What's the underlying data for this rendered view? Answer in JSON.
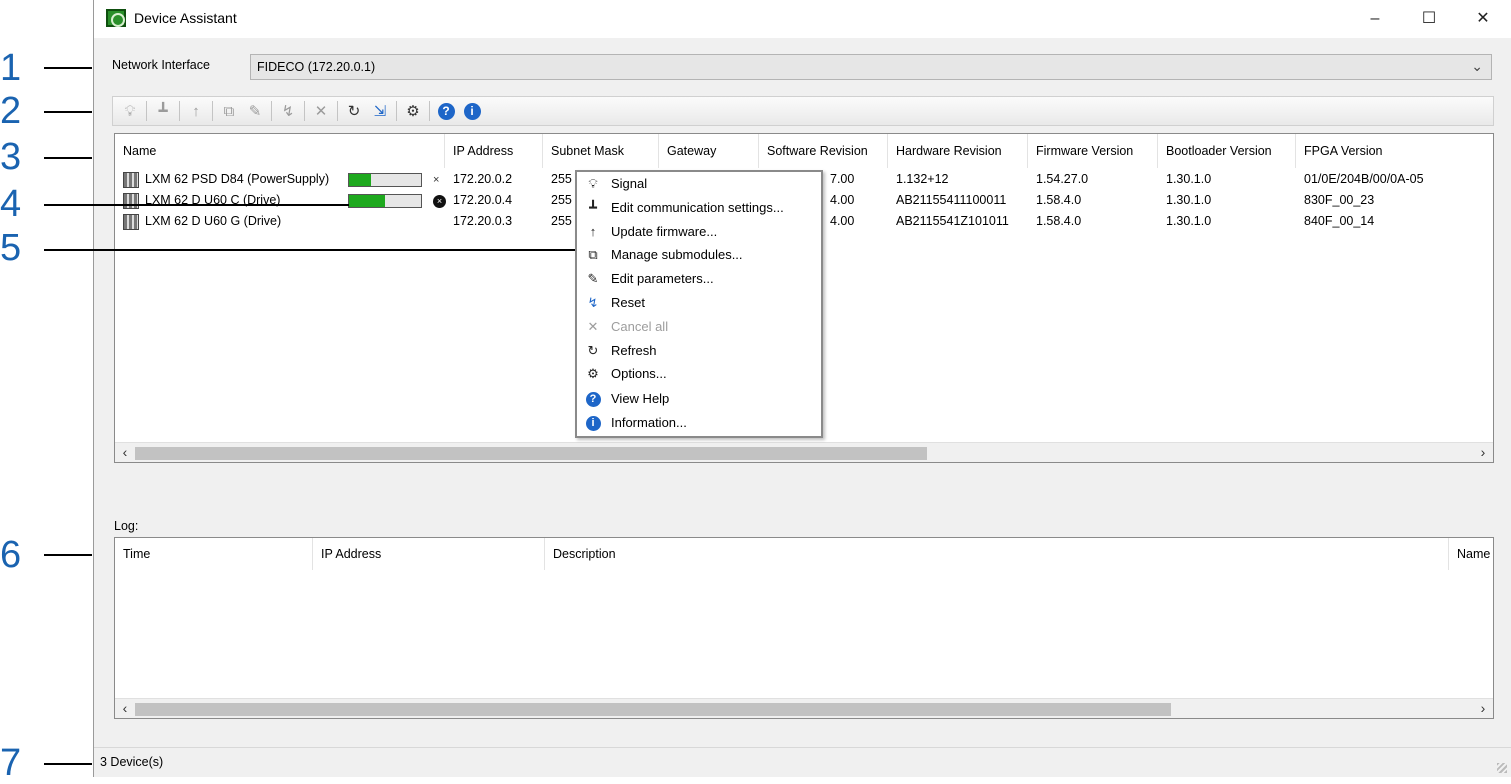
{
  "callouts": [
    "1",
    "2",
    "3",
    "4",
    "5",
    "6",
    "7"
  ],
  "window": {
    "title": "Device Assistant",
    "controls": {
      "minimize": "–",
      "maximize": "☐",
      "close": "✕"
    }
  },
  "network": {
    "label": "Network Interface",
    "value": "FIDECO (172.20.0.1)"
  },
  "toolbar": {
    "buttons": [
      {
        "name": "signal",
        "icon": "lightbulb-icon",
        "enabled": false
      },
      {
        "name": "edit-communication-settings",
        "icon": "network-icon",
        "enabled": false
      },
      {
        "name": "update-firmware",
        "icon": "arrow-up-icon",
        "enabled": false
      },
      {
        "name": "manage-submodules",
        "icon": "submodules-icon",
        "enabled": false
      },
      {
        "name": "edit-parameters",
        "icon": "pencil-icon",
        "enabled": false
      },
      {
        "name": "reset",
        "icon": "reset-icon",
        "enabled": false
      },
      {
        "name": "cancel-all",
        "icon": "x-icon",
        "enabled": false
      },
      {
        "name": "refresh",
        "icon": "refresh-icon",
        "enabled": true
      },
      {
        "name": "export",
        "icon": "export-icon",
        "enabled": true
      },
      {
        "name": "options",
        "icon": "gear-icon",
        "enabled": true
      },
      {
        "name": "view-help",
        "icon": "help-icon",
        "enabled": true
      },
      {
        "name": "information",
        "icon": "info-icon",
        "enabled": true
      }
    ]
  },
  "devices": {
    "columns": [
      "Name",
      "IP Address",
      "Subnet Mask",
      "Gateway",
      "Software Revision",
      "Hardware Revision",
      "Firmware Version",
      "Bootloader Version",
      "FPGA Version"
    ],
    "rows": [
      {
        "name": "LXM 62 PSD D84 (PowerSupply)",
        "progress": 0.3,
        "ip": "172.20.0.2",
        "subnet": "255",
        "sw": "7.00",
        "hw": "1.132+12",
        "fw": "1.54.27.0",
        "boot": "1.30.1.0",
        "fpga": "01/0E/204B/00/0A-05"
      },
      {
        "name": "LXM 62 D U60 C (Drive)",
        "progress": 0.5,
        "ip": "172.20.0.4",
        "subnet": "255",
        "sw": "4.00",
        "hw": "AB21155411100011",
        "fw": "1.58.4.0",
        "boot": "1.30.1.0",
        "fpga": "830F_00_23"
      },
      {
        "name": "LXM 62 D U60 G (Drive)",
        "progress": null,
        "ip": "172.20.0.3",
        "subnet": "255",
        "sw": "4.00",
        "hw": "AB2115541Z101011",
        "fw": "1.58.4.0",
        "boot": "1.30.1.0",
        "fpga": "840F_00_14"
      }
    ],
    "scroll_left": "‹",
    "scroll_right": "›"
  },
  "context_menu": {
    "items": [
      {
        "label": "Signal",
        "icon": "lightbulb-icon",
        "enabled": true
      },
      {
        "label": "Edit communication settings...",
        "icon": "network-icon",
        "enabled": true
      },
      {
        "label": "Update firmware...",
        "icon": "arrow-up-icon",
        "enabled": true
      },
      {
        "label": "Manage submodules...",
        "icon": "submodules-icon",
        "enabled": true
      },
      {
        "label": "Edit parameters...",
        "icon": "pencil-icon",
        "enabled": true
      },
      {
        "label": "Reset",
        "icon": "reset-icon",
        "enabled": true
      },
      {
        "label": "Cancel all",
        "icon": "x-icon",
        "enabled": false
      },
      {
        "label": "Refresh",
        "icon": "refresh-icon",
        "enabled": true
      },
      {
        "label": "Options...",
        "icon": "gear-icon",
        "enabled": true
      },
      {
        "label": "View Help",
        "icon": "help-icon",
        "enabled": true
      },
      {
        "label": "Information...",
        "icon": "info-icon",
        "enabled": true
      }
    ]
  },
  "log": {
    "label": "Log:",
    "columns": [
      "Time",
      "IP Address",
      "Description",
      "Name"
    ]
  },
  "status": {
    "text": "3 Device(s)"
  },
  "colors": {
    "callout": "#1a63b0",
    "progress": "#1ea91e",
    "help_blue": "#1e66c8"
  }
}
